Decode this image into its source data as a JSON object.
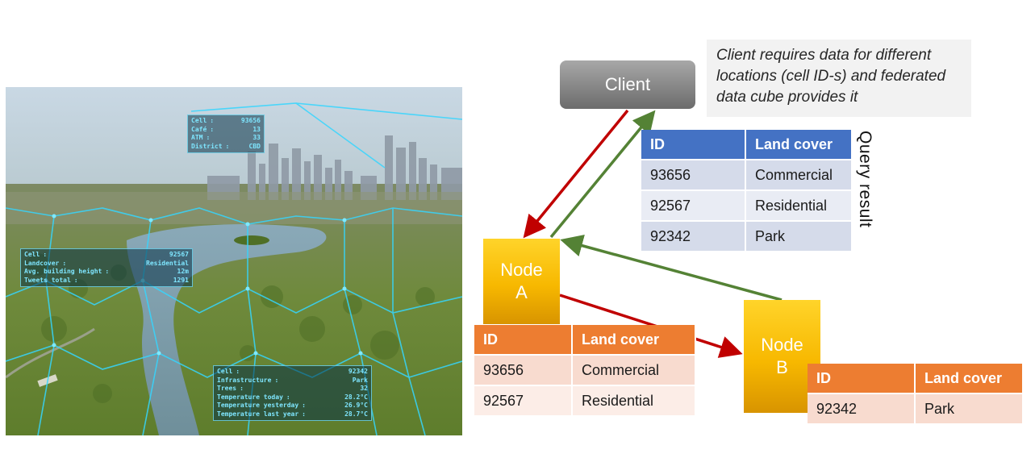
{
  "hud": {
    "top": {
      "rows": [
        {
          "k": "Cell",
          "v": "93656"
        },
        {
          "k": "Café",
          "v": "13"
        },
        {
          "k": "ATM",
          "v": "33"
        },
        {
          "k": "District",
          "v": "CBD"
        }
      ]
    },
    "left": {
      "rows": [
        {
          "k": "Cell",
          "v": "92567"
        },
        {
          "k": "Landcover",
          "v": "Residential"
        },
        {
          "k": "Avg. building height",
          "v": "12m"
        },
        {
          "k": "Tweets total",
          "v": "1291"
        }
      ]
    },
    "bottom": {
      "rows": [
        {
          "k": "Cell",
          "v": "92342"
        },
        {
          "k": "Infrastructure",
          "v": "Park"
        },
        {
          "k": "Trees",
          "v": "32"
        },
        {
          "k": "Temperature today",
          "v": "28.2°C"
        },
        {
          "k": "Temperature yesterday",
          "v": "26.9°C"
        },
        {
          "k": "Temperature last year",
          "v": "28.7°C"
        }
      ]
    }
  },
  "diagram": {
    "client_label": "Client",
    "note": "Client requires data for different locations (cell ID-s) and federated data cube provides it",
    "node_a": {
      "line1": "Node",
      "line2": "A"
    },
    "node_b": {
      "line1": "Node",
      "line2": "B"
    },
    "query_result_label": "Query result",
    "query_table": {
      "headers": [
        "ID",
        "Land cover"
      ],
      "rows": [
        [
          "93656",
          "Commercial"
        ],
        [
          "92567",
          "Residential"
        ],
        [
          "92342",
          "Park"
        ]
      ]
    },
    "node_a_table": {
      "headers": [
        "ID",
        "Land cover"
      ],
      "rows": [
        [
          "93656",
          "Commercial"
        ],
        [
          "92567",
          "Residential"
        ]
      ]
    },
    "node_b_table": {
      "headers": [
        "ID",
        "Land cover"
      ],
      "rows": [
        [
          "92342",
          "Park"
        ]
      ]
    },
    "colors": {
      "request_arrow": "#c00000",
      "response_arrow": "#548235",
      "client_fill": "#8c8c8c",
      "node_fill": "#ffc000",
      "query_header": "#4472c4",
      "node_header": "#ed7d31"
    }
  }
}
